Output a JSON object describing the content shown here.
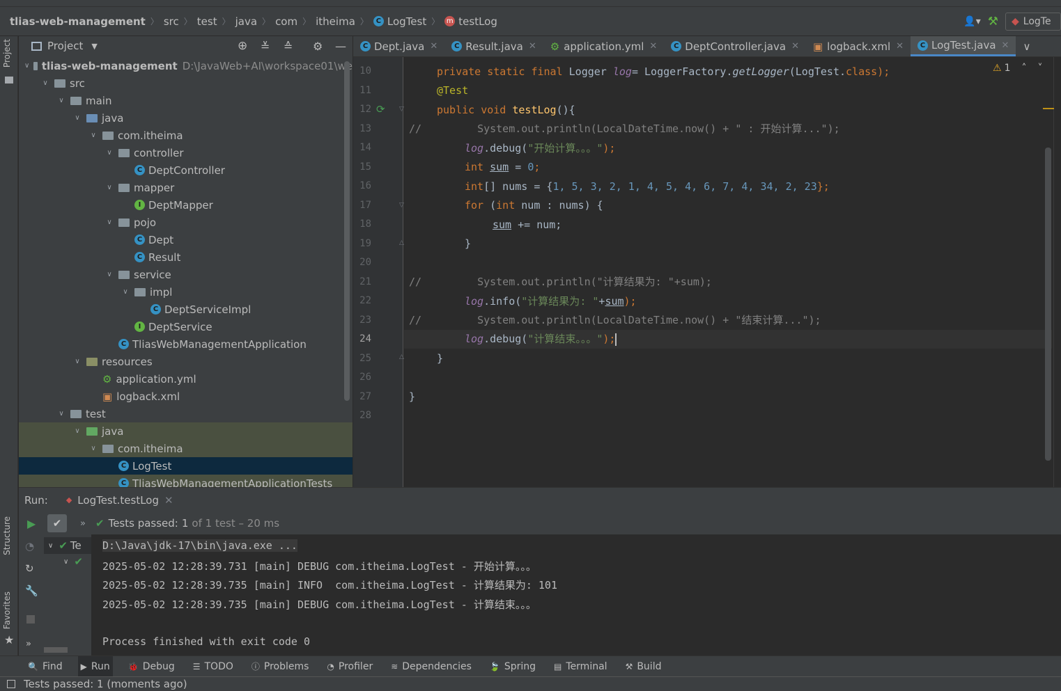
{
  "breadcrumb": [
    "tlias-web-management",
    "src",
    "test",
    "java",
    "com",
    "itheima",
    "LogTest",
    "testLog"
  ],
  "navbar_right": {
    "run_config": "LogTe"
  },
  "left_stripe": {
    "project": "Project",
    "structure": "Structure",
    "favorites": "Favorites"
  },
  "project_panel": {
    "title": "Project",
    "tree": [
      {
        "label": "tlias-web-management",
        "path": "D:\\JavaWeb+AI\\workspace01\\we",
        "indent": 0,
        "type": "module"
      },
      {
        "label": "src",
        "indent": 1,
        "type": "folder"
      },
      {
        "label": "main",
        "indent": 2,
        "type": "folder"
      },
      {
        "label": "java",
        "indent": 3,
        "type": "src"
      },
      {
        "label": "com.itheima",
        "indent": 4,
        "type": "package"
      },
      {
        "label": "controller",
        "indent": 5,
        "type": "package"
      },
      {
        "label": "DeptController",
        "indent": 6,
        "type": "class"
      },
      {
        "label": "mapper",
        "indent": 5,
        "type": "package"
      },
      {
        "label": "DeptMapper",
        "indent": 6,
        "type": "interface"
      },
      {
        "label": "pojo",
        "indent": 5,
        "type": "package"
      },
      {
        "label": "Dept",
        "indent": 6,
        "type": "class"
      },
      {
        "label": "Result",
        "indent": 6,
        "type": "class"
      },
      {
        "label": "service",
        "indent": 5,
        "type": "package"
      },
      {
        "label": "impl",
        "indent": 6,
        "type": "package"
      },
      {
        "label": "DeptServiceImpl",
        "indent": 7,
        "type": "class"
      },
      {
        "label": "DeptService",
        "indent": 6,
        "type": "interface"
      },
      {
        "label": "TliasWebManagementApplication",
        "indent": 5,
        "type": "springclass"
      },
      {
        "label": "resources",
        "indent": 3,
        "type": "res"
      },
      {
        "label": "application.yml",
        "indent": 4,
        "type": "yml"
      },
      {
        "label": "logback.xml",
        "indent": 4,
        "type": "xml"
      },
      {
        "label": "test",
        "indent": 2,
        "type": "folder"
      },
      {
        "label": "java",
        "indent": 3,
        "type": "tst"
      },
      {
        "label": "com.itheima",
        "indent": 4,
        "type": "package"
      },
      {
        "label": "LogTest",
        "indent": 5,
        "type": "springclass"
      },
      {
        "label": "TliasWebManagementApplicationTests",
        "indent": 5,
        "type": "springclass"
      }
    ]
  },
  "editor_tabs": [
    {
      "label": "Dept.java",
      "icon": "class-icon"
    },
    {
      "label": "Result.java",
      "icon": "class-icon"
    },
    {
      "label": "application.yml",
      "icon": "yml-icon"
    },
    {
      "label": "DeptController.java",
      "icon": "class-icon"
    },
    {
      "label": "logback.xml",
      "icon": "xml-icon"
    },
    {
      "label": "LogTest.java",
      "icon": "class-icon",
      "active": true
    }
  ],
  "editor": {
    "warnings": "1",
    "line_numbers": [
      "10",
      "11",
      "12",
      "13",
      "14",
      "15",
      "16",
      "17",
      "18",
      "19",
      "20",
      "21",
      "22",
      "23",
      "24",
      "25",
      "26",
      "27",
      "28"
    ],
    "current_line": "24",
    "code": {
      "l10": {
        "kw": "private static final ",
        "type": "Logger ",
        "var": "log",
        "eq": "= LoggerFactory.",
        "fn": "getLogger",
        "arg": "(LogTest.",
        "cls": "class",
        "end": ");"
      },
      "l11": "@Test",
      "l12": {
        "kw": "public void ",
        "fn": "testLog",
        "end": "(){"
      },
      "l13": {
        "cm": "//",
        "code": "System.out.println(LocalDateTime.now() + \" : 开始计算...\");"
      },
      "l14": {
        "var": "log",
        "call": ".debug(",
        "str": "\"开始计算。。。\"",
        "end": ");"
      },
      "l15": {
        "kw": "int ",
        "var": "sum",
        "eq": " = ",
        "num": "0",
        "end": ";"
      },
      "l16": {
        "kw": "int",
        "rest": "[] nums = {",
        "nums": "1, 5, 3, 2, 1, 4, 5, 4, 6, 7, 4, 34, 2, 23",
        "end": "};"
      },
      "l17": {
        "kw": "for ",
        "p": "(",
        "kw2": "int ",
        "rest": "num : nums) {"
      },
      "l18": {
        "var": "sum",
        "rest": " += num;"
      },
      "l19": "}",
      "l21": {
        "cm": "//",
        "code": "System.out.println(\"计算结果为: \"+sum);"
      },
      "l22": {
        "var": "log",
        "call": ".info(",
        "str": "\"计算结果为: \"",
        "plus": "+",
        "sum": "sum",
        "end": ");"
      },
      "l23": {
        "cm": "//",
        "code": "System.out.println(LocalDateTime.now() + \"结束计算...\");"
      },
      "l24": {
        "var": "log",
        "call": ".debug(",
        "str": "\"计算结束。。。\"",
        "end": ");"
      },
      "l25": "}",
      "l27": "}"
    }
  },
  "run_panel": {
    "label": "Run:",
    "tab": "LogTest.testLog",
    "status_prefix": "Tests passed:",
    "status_count": "1",
    "status_rest": "of 1 test – 20 ms",
    "tree_label": "Te",
    "console": [
      "D:\\Java\\jdk-17\\bin\\java.exe ...",
      "2025-05-02 12:28:39.731 [main] DEBUG com.itheima.LogTest - 开始计算。。。",
      "2025-05-02 12:28:39.735 [main] INFO  com.itheima.LogTest - 计算结果为: 101",
      "2025-05-02 12:28:39.735 [main] DEBUG com.itheima.LogTest - 计算结束。。。",
      "",
      "Process finished with exit code 0"
    ]
  },
  "bottom_tools": [
    {
      "label": "Find",
      "icon": "search-icon"
    },
    {
      "label": "Run",
      "icon": "play-icon",
      "active": true
    },
    {
      "label": "Debug",
      "icon": "bug-icon"
    },
    {
      "label": "TODO",
      "icon": "list-icon"
    },
    {
      "label": "Problems",
      "icon": "info-icon"
    },
    {
      "label": "Profiler",
      "icon": "profiler-icon"
    },
    {
      "label": "Dependencies",
      "icon": "layers-icon"
    },
    {
      "label": "Spring",
      "icon": "spring-icon"
    },
    {
      "label": "Terminal",
      "icon": "terminal-icon"
    },
    {
      "label": "Build",
      "icon": "hammer-icon"
    }
  ],
  "status_bar": {
    "text": "Tests passed: 1 (moments ago)"
  },
  "colors": {
    "accent": "#4a88c7",
    "keyword": "#cc7832",
    "string": "#6a8759",
    "number": "#6897bb",
    "pass": "#499c54"
  }
}
